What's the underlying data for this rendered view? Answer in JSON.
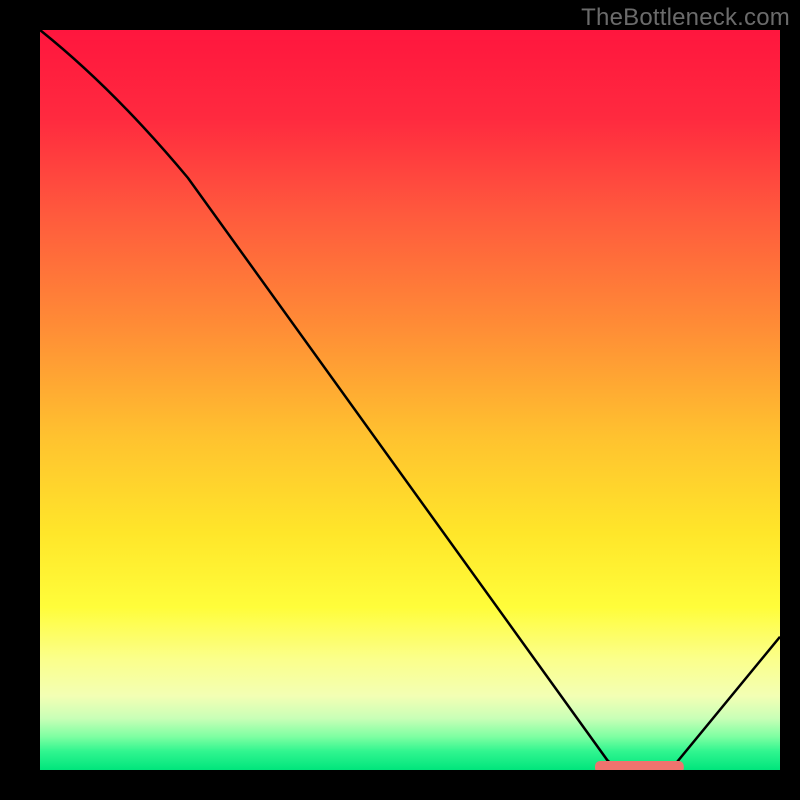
{
  "watermark": "TheBottleneck.com",
  "chart_data": {
    "type": "line",
    "title": "",
    "xlabel": "",
    "ylabel": "",
    "xlim": [
      0,
      100
    ],
    "ylim": [
      0,
      100
    ],
    "x": [
      0,
      20,
      78,
      85,
      100
    ],
    "values": [
      100,
      80,
      0,
      0,
      18
    ],
    "optimal_band": {
      "x_start": 75,
      "x_end": 87,
      "y": 0
    },
    "background_gradient": {
      "stops": [
        {
          "offset": 0.0,
          "color": "#ff163e"
        },
        {
          "offset": 0.12,
          "color": "#ff2a3f"
        },
        {
          "offset": 0.25,
          "color": "#ff5a3d"
        },
        {
          "offset": 0.4,
          "color": "#ff8c36"
        },
        {
          "offset": 0.55,
          "color": "#ffc22f"
        },
        {
          "offset": 0.68,
          "color": "#ffe62a"
        },
        {
          "offset": 0.78,
          "color": "#fffd3a"
        },
        {
          "offset": 0.85,
          "color": "#fbff8b"
        },
        {
          "offset": 0.9,
          "color": "#f3ffb4"
        },
        {
          "offset": 0.93,
          "color": "#c9ffb7"
        },
        {
          "offset": 0.955,
          "color": "#7effa2"
        },
        {
          "offset": 0.975,
          "color": "#30f58f"
        },
        {
          "offset": 1.0,
          "color": "#00e57c"
        }
      ]
    },
    "line_color": "#000000",
    "marker_color": "#ef736e"
  }
}
